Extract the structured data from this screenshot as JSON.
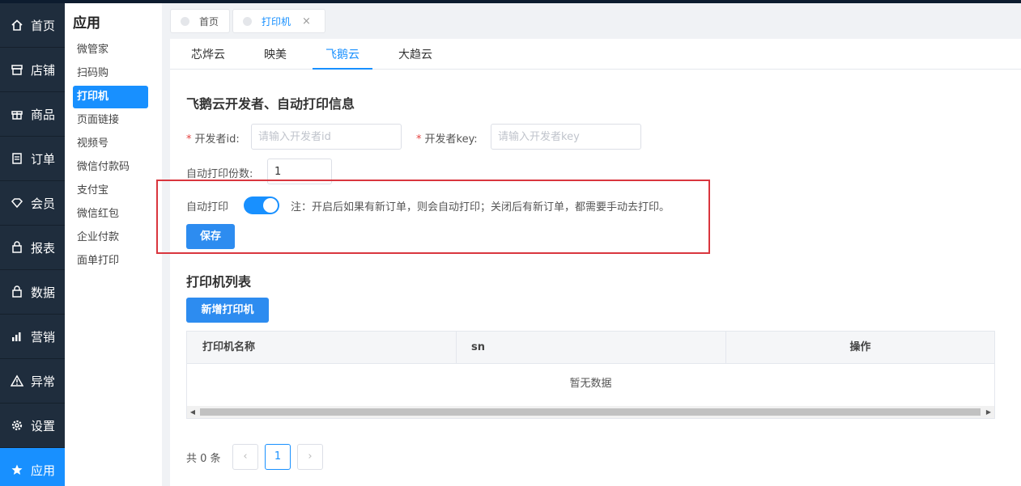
{
  "nav": [
    {
      "label": "首页",
      "icon": "home-icon"
    },
    {
      "label": "店铺",
      "icon": "store-icon"
    },
    {
      "label": "商品",
      "icon": "gift-icon"
    },
    {
      "label": "订单",
      "icon": "order-icon"
    },
    {
      "label": "会员",
      "icon": "diamond-icon"
    },
    {
      "label": "报表",
      "icon": "lock-bag-icon"
    },
    {
      "label": "数据",
      "icon": "lock-bag-icon"
    },
    {
      "label": "营销",
      "icon": "bar-chart-icon"
    },
    {
      "label": "异常",
      "icon": "warning-icon"
    },
    {
      "label": "设置",
      "icon": "gear-icon"
    },
    {
      "label": "应用",
      "icon": "star-icon"
    }
  ],
  "subnav": {
    "title": "应用",
    "items": [
      "微管家",
      "扫码购",
      "打印机",
      "页面链接",
      "视频号",
      "微信付款码",
      "支付宝",
      "微信红包",
      "企业付款",
      "面单打印"
    ],
    "active": "打印机"
  },
  "page_tabs": [
    {
      "label": "首页"
    },
    {
      "label": "打印机",
      "close": "×"
    }
  ],
  "sub_tabs": [
    "芯烨云",
    "映美",
    "飞鹅云",
    "大趋云"
  ],
  "form": {
    "title": "飞鹅云开发者、自动打印信息",
    "required_mark": "*",
    "dev_id_label": "开发者id:",
    "dev_id_placeholder": "请输入开发者id",
    "dev_key_label": "开发者key:",
    "dev_key_placeholder": "请输入开发者key",
    "copies_label": "自动打印份数:",
    "copies_value": "1",
    "auto_print_label": "自动打印",
    "auto_print_on": true,
    "note": "注：开启后如果有新订单，则会自动打印；关闭后有新订单，都需要手动去打印。",
    "save_label": "保存"
  },
  "printer_list": {
    "title": "打印机列表",
    "add_label": "新增打印机",
    "columns": [
      "打印机名称",
      "sn",
      "操作"
    ],
    "empty_text": "暂无数据",
    "total_text": "共 0 条",
    "prev": "‹",
    "page": "1",
    "next": "›"
  },
  "colors": {
    "accent": "#1890ff",
    "nav_bg": "#1f2d3d",
    "highlight_border": "#d9363e"
  }
}
